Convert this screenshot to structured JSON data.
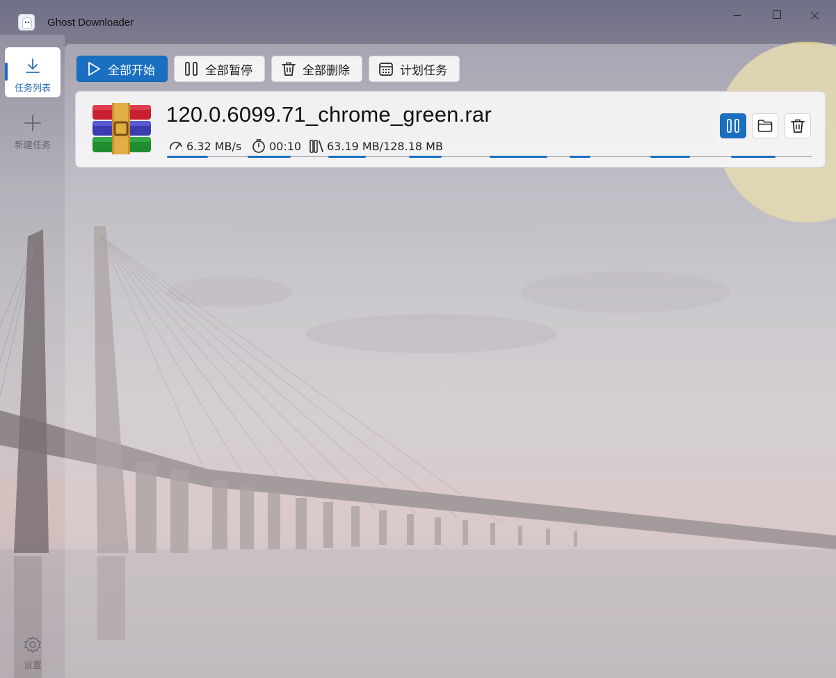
{
  "window": {
    "title": "Ghost Downloader"
  },
  "sidebar": {
    "items": [
      {
        "label": "任务列表",
        "icon": "download-icon",
        "active": true
      },
      {
        "label": "新建任务",
        "icon": "plus-icon",
        "active": false
      }
    ],
    "settings": {
      "label": "设置",
      "icon": "gear-icon"
    }
  },
  "toolbar": {
    "start_all": "全部开始",
    "pause_all": "全部暂停",
    "delete_all": "全部删除",
    "schedule": "计划任务"
  },
  "task": {
    "file_name": "120.0.6099.71_chrome_green.rar",
    "file_icon": "winrar-archive-icon",
    "speed": "6.32 MB/s",
    "time": "00:10",
    "size": "63.19 MB/128.18 MB",
    "progress_fraction": 0.493,
    "segments": 8
  },
  "colors": {
    "accent": "#1a6fc0",
    "card_bg": "#f4f3f5",
    "active_label": "#2a6db8"
  }
}
